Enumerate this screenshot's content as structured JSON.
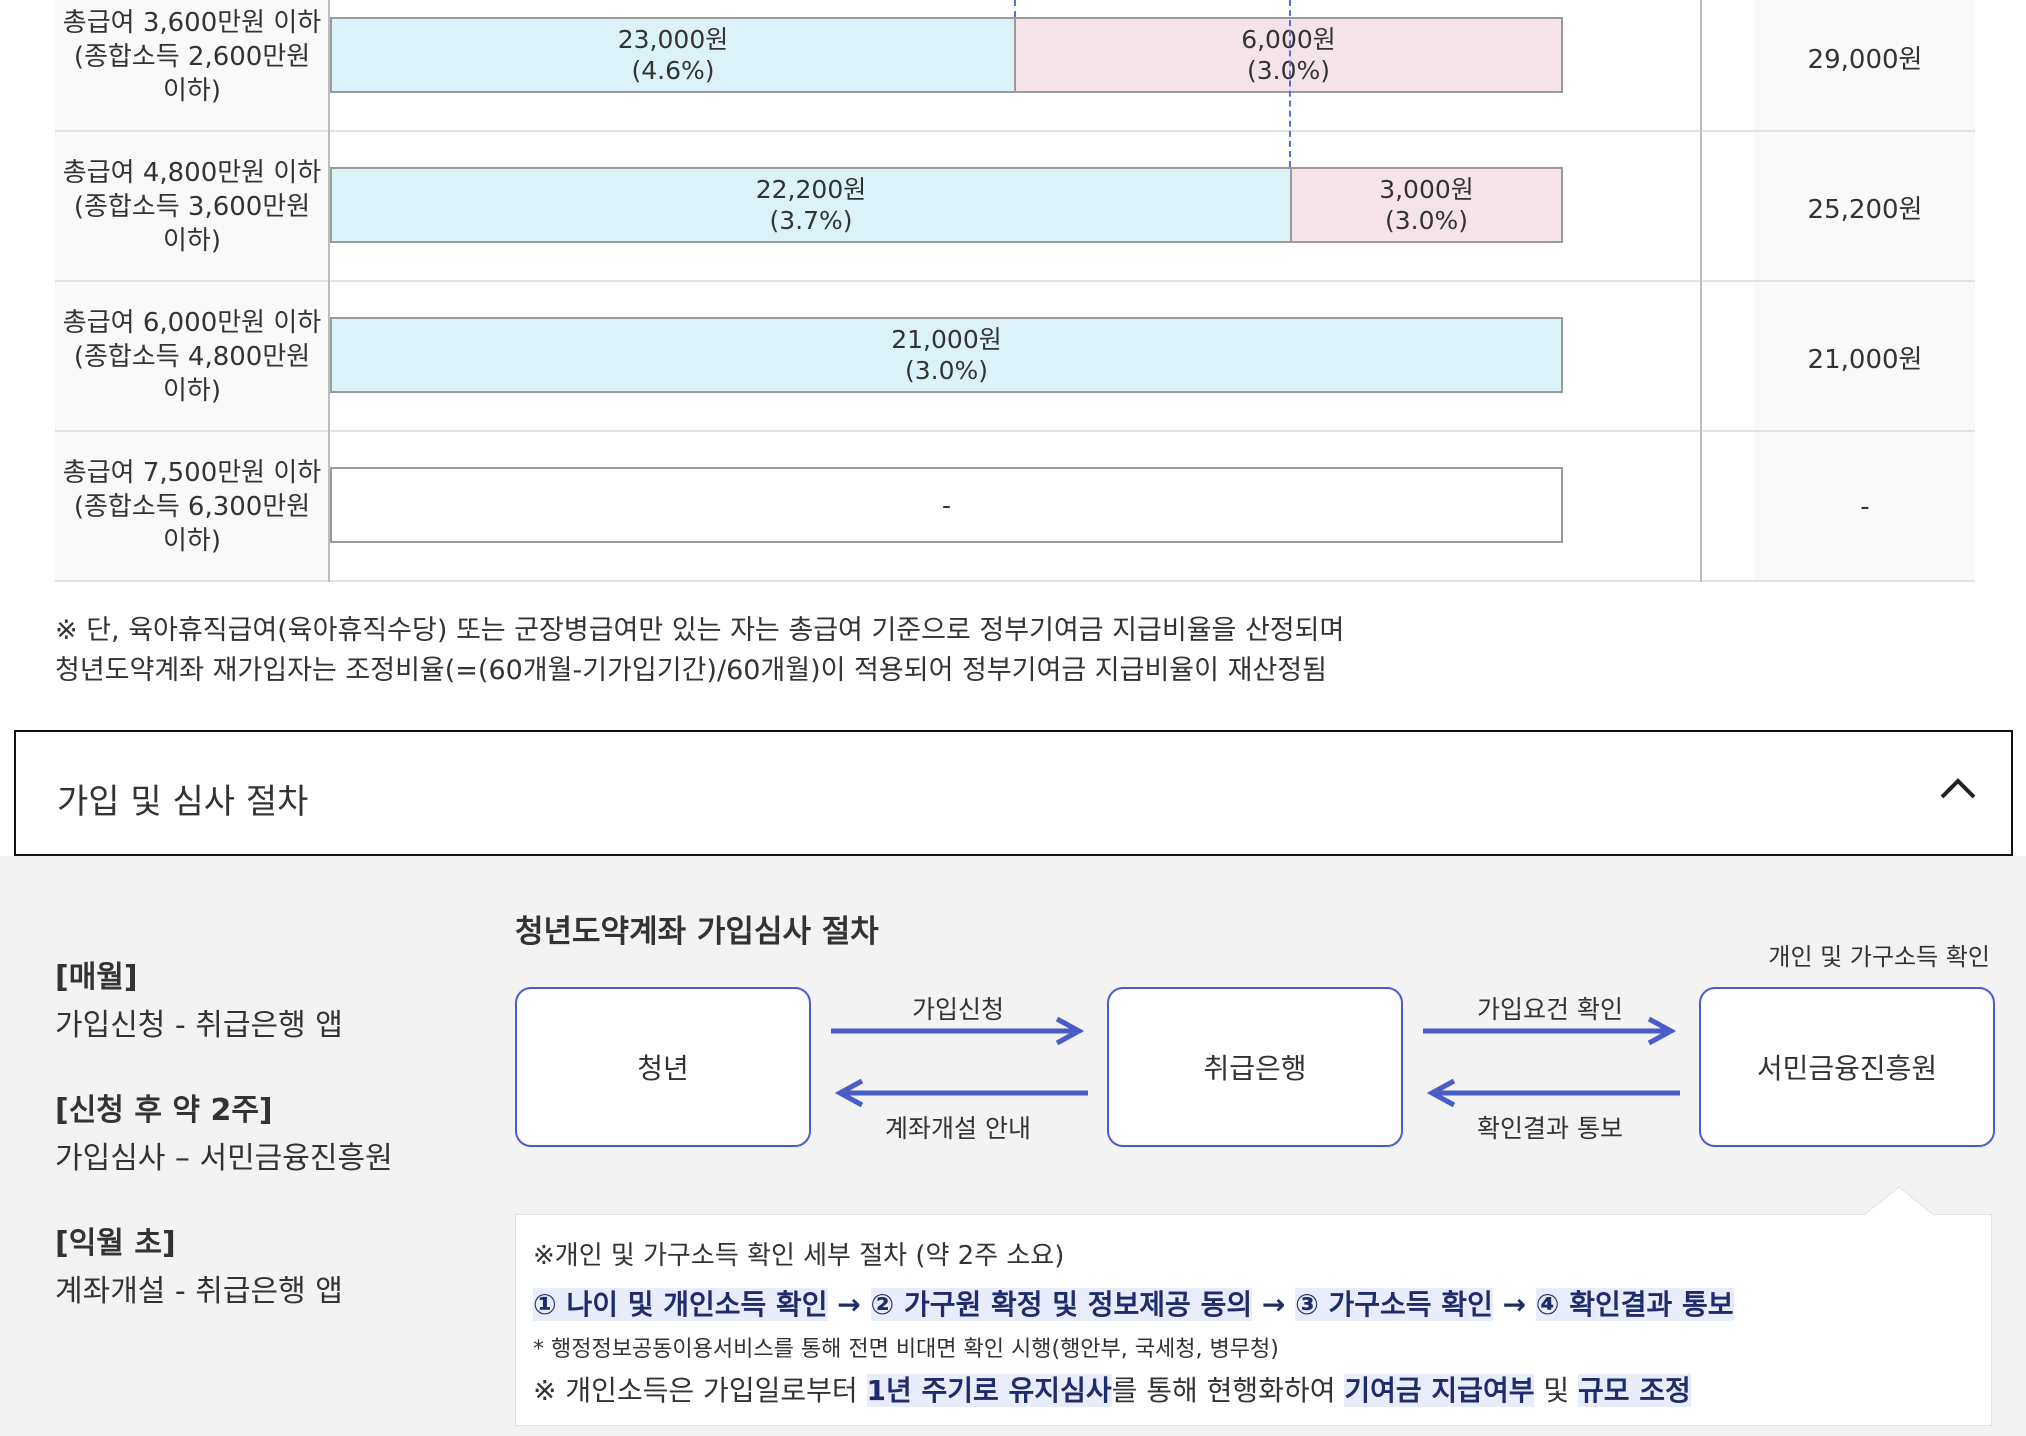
{
  "table": {
    "rows": [
      {
        "label": "총급여 3,600만원 이하 (종합소득 2,600만원 이하)",
        "total": "29,000원",
        "segments": [
          {
            "amount": "23,000원",
            "rate": "(4.6%)",
            "kind": "blue"
          },
          {
            "amount": "6,000원",
            "rate": "(3.0%)",
            "kind": "pink"
          }
        ]
      },
      {
        "label": "총급여 4,800만원 이하 (종합소득 3,600만원 이하)",
        "total": "25,200원",
        "segments": [
          {
            "amount": "22,200원",
            "rate": "(3.7%)",
            "kind": "blue"
          },
          {
            "amount": "3,000원",
            "rate": "(3.0%)",
            "kind": "pink"
          }
        ]
      },
      {
        "label": "총급여 6,000만원 이하 (종합소득 4,800만원 이하)",
        "total": "21,000원",
        "segments": [
          {
            "amount": "21,000원",
            "rate": "(3.0%)",
            "kind": "blue"
          }
        ]
      },
      {
        "label": "총급여 7,500만원 이하 (종합소득 6,300만원 이하)",
        "total": "-",
        "segments": [
          {
            "amount": "-",
            "rate": "",
            "kind": "empty"
          }
        ]
      }
    ]
  },
  "note": {
    "line1": "※ 단, 육아휴직급여(육아휴직수당) 또는 군장병급여만 있는 자는 총급여 기준으로 정부기여금 지급비율을 산정되며",
    "line2": "청년도약계좌 재가입자는 조정비율(=(60개월-기가입기간)/60개월)이 적용되어 정부기여금 지급비율이 재산정됨"
  },
  "accordion": {
    "title": "가입 및 심사 절차",
    "icon": "chevron-up-icon"
  },
  "steps": [
    {
      "head": "[매월]",
      "desc": "가입신청 - 취급은행 앱"
    },
    {
      "head": "[신청 후 약 2주]",
      "desc": "가입심사 – 서민금융진흥원"
    },
    {
      "head": "[익월 초]",
      "desc": "계좌개설 - 취급은행 앱"
    }
  ],
  "flow": {
    "title": "청년도약계좌 가입심사 절차",
    "caption": "개인 및 가구소득 확인",
    "nodes": [
      "청년",
      "취급은행",
      "서민금융진흥원"
    ],
    "arrows": [
      {
        "top": "가입신청",
        "bottom": "계좌개설 안내"
      },
      {
        "top": "가입요건 확인",
        "bottom": "확인결과 통보"
      }
    ],
    "accent": "#4a5cc6"
  },
  "detail": {
    "l1": "※개인 및 가구소득 확인 세부 절차 (약 2주 소요)",
    "steps": [
      "① 나이 및 개인소득 확인",
      "② 가구원 확정 및 정보제공 동의",
      "③ 가구소득 확인",
      "④ 확인결과 통보"
    ],
    "sep": " → ",
    "l3": "* 행정정보공동이용서비스를 통해 전면 비대면 확인 시행(행안부, 국세청, 병무청)",
    "l4a": "※ 개인소득은 가입일로부터 ",
    "l4b": "1년 주기로 유지심사",
    "l4c": "를 통해 현행화하여 ",
    "l4d": "기여금 지급여부",
    "l4e": " 및 ",
    "l4f": "규모 조정"
  }
}
